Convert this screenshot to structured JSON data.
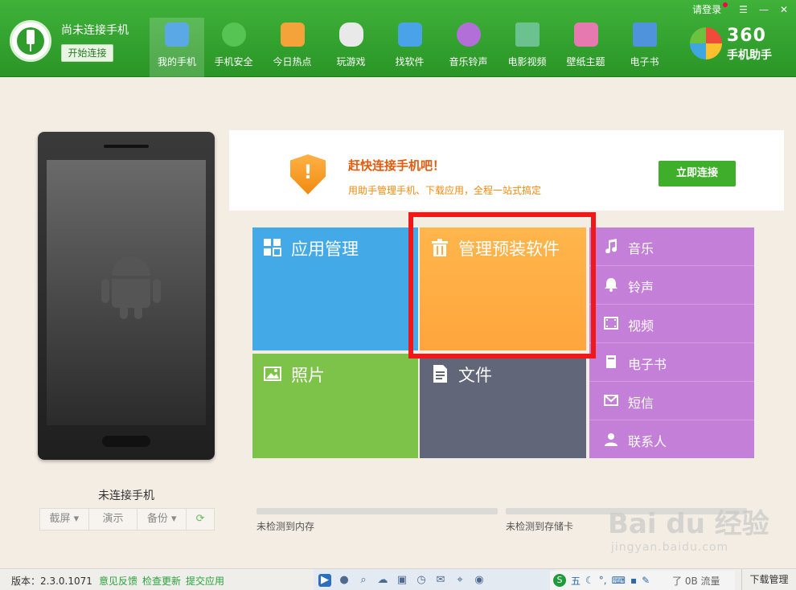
{
  "header": {
    "connection_title": "尚未连接手机",
    "start_connect": "开始连接",
    "login": "请登录",
    "nav": [
      {
        "label": "我的手机",
        "icon": "phone-icon",
        "color": "#5aa9e6"
      },
      {
        "label": "手机安全",
        "icon": "shield-icon",
        "color": "#56c452"
      },
      {
        "label": "今日热点",
        "icon": "star-icon",
        "color": "#f4a33a"
      },
      {
        "label": "玩游戏",
        "icon": "gamepad-icon",
        "color": "#e9e9e9"
      },
      {
        "label": "找软件",
        "icon": "shopping-bag-icon",
        "color": "#4aa3e8"
      },
      {
        "label": "音乐铃声",
        "icon": "music-icon",
        "color": "#b36fd8"
      },
      {
        "label": "电影视频",
        "icon": "film-icon",
        "color": "#6bc28f"
      },
      {
        "label": "壁纸主题",
        "icon": "picture-icon",
        "color": "#e679b0"
      },
      {
        "label": "电子书",
        "icon": "book-icon",
        "color": "#4f93dc"
      }
    ],
    "logo_top": "360",
    "logo_bottom": "手机助手"
  },
  "phone": {
    "status": "未连接手机",
    "tools": [
      "截屏 ▾",
      "演示",
      "备份 ▾",
      "⟳"
    ]
  },
  "banner": {
    "shield_mark": "!",
    "title": "赶快连接手机吧！",
    "subtitle": "用助手管理手机、下载应用，全程一站式搞定",
    "connect_now": "立即连接"
  },
  "tiles": {
    "app_manage": "应用管理",
    "preinstalled": "管理预装软件",
    "photos": "照片",
    "files": "文件",
    "media": [
      {
        "label": "音乐",
        "icon": "music-note-icon"
      },
      {
        "label": "铃声",
        "icon": "bell-icon"
      },
      {
        "label": "视频",
        "icon": "video-icon"
      },
      {
        "label": "电子书",
        "icon": "ebook-icon"
      },
      {
        "label": "短信",
        "icon": "mail-icon"
      },
      {
        "label": "联系人",
        "icon": "contact-icon"
      }
    ]
  },
  "storage": {
    "memory": "未检测到内存",
    "sdcard": "未检测到存储卡"
  },
  "statusbar": {
    "version": "版本：2.3.0.1071",
    "links": [
      "意见反馈",
      "检查更新",
      "提交应用"
    ],
    "traffic": "了 0B 流量",
    "download_manage": "下载管理",
    "ime_label": "五"
  },
  "watermark": {
    "line1": "Bai du 经验",
    "line2": "jingyan.baidu.com"
  },
  "colors": {
    "header_green": "#3fb23a",
    "app_tile": "#44a9e7",
    "preinstall_tile": "#ffa53d",
    "photo_tile": "#7dc249",
    "file_tile": "#626679",
    "media_tile": "#c47fd9",
    "highlight": "#f01818"
  }
}
